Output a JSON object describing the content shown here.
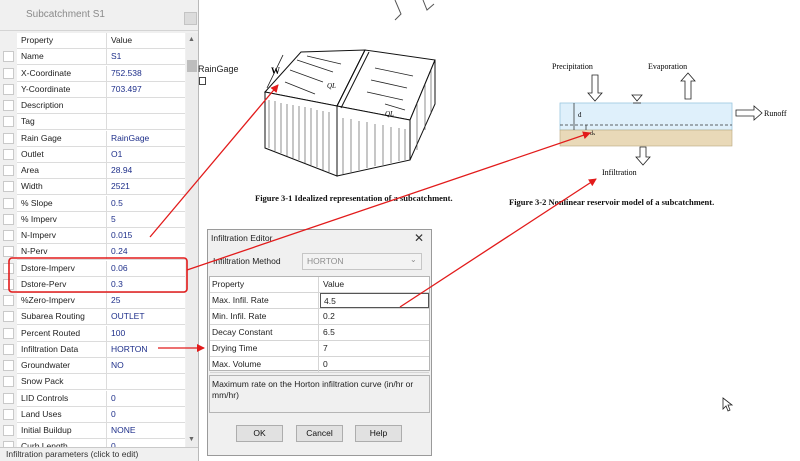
{
  "panel": {
    "title": "Subcatchment S1",
    "columns": {
      "property": "Property",
      "value": "Value"
    },
    "rows": [
      {
        "property": "Name",
        "value": "S1"
      },
      {
        "property": "X-Coordinate",
        "value": "752.538"
      },
      {
        "property": "Y-Coordinate",
        "value": "703.497"
      },
      {
        "property": "Description",
        "value": ""
      },
      {
        "property": "Tag",
        "value": ""
      },
      {
        "property": "Rain Gage",
        "value": "RainGage"
      },
      {
        "property": "Outlet",
        "value": "O1"
      },
      {
        "property": "Area",
        "value": "28.94"
      },
      {
        "property": "Width",
        "value": "2521"
      },
      {
        "property": "% Slope",
        "value": "0.5"
      },
      {
        "property": "% Imperv",
        "value": "5"
      },
      {
        "property": "N-Imperv",
        "value": "0.015"
      },
      {
        "property": "N-Perv",
        "value": "0.24"
      },
      {
        "property": "Dstore-Imperv",
        "value": "0.06"
      },
      {
        "property": "Dstore-Perv",
        "value": "0.3"
      },
      {
        "property": "%Zero-Imperv",
        "value": "25"
      },
      {
        "property": "Subarea Routing",
        "value": "OUTLET"
      },
      {
        "property": "Percent Routed",
        "value": "100"
      },
      {
        "property": "Infiltration Data",
        "value": "HORTON"
      },
      {
        "property": "Groundwater",
        "value": "NO"
      },
      {
        "property": "Snow Pack",
        "value": ""
      },
      {
        "property": "LID Controls",
        "value": "0"
      },
      {
        "property": "Land Uses",
        "value": "0"
      },
      {
        "property": "Initial Buildup",
        "value": "NONE"
      },
      {
        "property": "Curb Length",
        "value": "0"
      }
    ],
    "status": "Infiltration parameters (click to edit)"
  },
  "map_label": "RainGage",
  "figure1": {
    "caption": "Figure 3-1 Idealized representation of a subcatchment.",
    "labels": {
      "w": "W",
      "q1": "QL",
      "q2": "QL"
    }
  },
  "figure2": {
    "caption": "Figure 3-2 Nonlinear reservoir model of a subcatchment.",
    "labels": {
      "precipitation": "Precipitation",
      "evaporation": "Evaporation",
      "runoff": "Runoff",
      "infiltration": "Infiltration",
      "d": "d",
      "ds": "dₛ"
    }
  },
  "dialog": {
    "title": "Infiltration Editor",
    "method_label": "Infiltration Method",
    "method_value": "HORTON",
    "columns": {
      "property": "Property",
      "value": "Value"
    },
    "rows": [
      {
        "property": "Max. Infil. Rate",
        "value": "4.5"
      },
      {
        "property": "Min. Infil. Rate",
        "value": "0.2"
      },
      {
        "property": "Decay Constant",
        "value": "6.5"
      },
      {
        "property": "Drying Time",
        "value": "7"
      },
      {
        "property": "Max. Volume",
        "value": "0"
      }
    ],
    "description": "Maximum rate on the Horton infiltration curve (in/hr or mm/hr)",
    "buttons": {
      "ok": "OK",
      "cancel": "Cancel",
      "help": "Help"
    }
  },
  "colors": {
    "annotation": "#e21b1b",
    "value_text": "#1e2f8a",
    "water": "#dff0fb",
    "soil": "#e9d9b8"
  }
}
